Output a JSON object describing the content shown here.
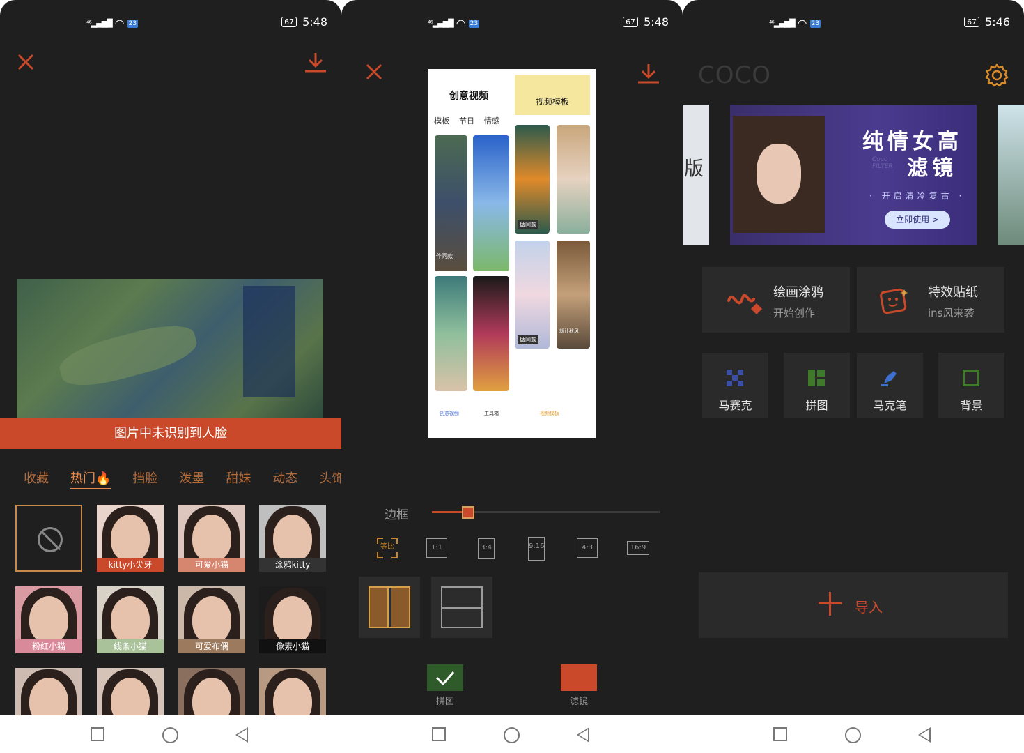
{
  "colors": {
    "accent": "#c9492a",
    "background": "#1f1f1f",
    "card": "#2a2a2a"
  },
  "screens": [
    {
      "status": {
        "battery": "67",
        "time": "5:48",
        "network": "46",
        "badge": "23"
      },
      "banner_text": "图片中未识别到人脸",
      "tabs": [
        "收藏",
        "热门🔥",
        "挡脸",
        "泼墨",
        "甜妹",
        "动态",
        "头饰"
      ],
      "active_tab_index": 1,
      "stickers": [
        "kitty小尖牙",
        "可爱小猫",
        "涂鸦kitty",
        "粉红小猫",
        "线条小猫",
        "可爱布偶",
        "像素小猫"
      ],
      "icons": {
        "close": "close-icon",
        "download": "download-icon",
        "none": "no-entry-icon"
      }
    },
    {
      "status": {
        "battery": "67",
        "time": "5:48",
        "network": "46",
        "badge": "23"
      },
      "preview_left_title": "创意视频",
      "preview_right_title": "视频模板",
      "preview_subtabs": [
        "模板",
        "节日",
        "情感"
      ],
      "preview_bottom_tabs": [
        "创意视频",
        "工具箱",
        "视频模板"
      ],
      "preview_thumb_labels": [
        "作同款",
        "做同款",
        "做同款",
        "就让秋风"
      ],
      "border_label": "边框",
      "border_value": 0.16,
      "ratios": [
        "等比",
        "1:1",
        "3:4",
        "9:16",
        "4:3",
        "16:9"
      ],
      "bottom_actions": [
        "拼图",
        "滤镜"
      ]
    },
    {
      "status": {
        "battery": "67",
        "time": "5:46",
        "network": "46",
        "badge": "23"
      },
      "brand": "COCO",
      "carousel": {
        "title_line1": "纯情女高",
        "title_line2": "滤镜",
        "subtitle": "· 开启清冷复古 ·",
        "cta": "立即使用 >",
        "watermark": "Coco FILTER"
      },
      "features": [
        {
          "title": "绘画涂鸦",
          "subtitle": "开始创作"
        },
        {
          "title": "特效贴纸",
          "subtitle": "ins风来袭"
        }
      ],
      "tools": [
        "马赛克",
        "拼图",
        "马克笔",
        "背景"
      ],
      "import_label": "导入"
    }
  ]
}
